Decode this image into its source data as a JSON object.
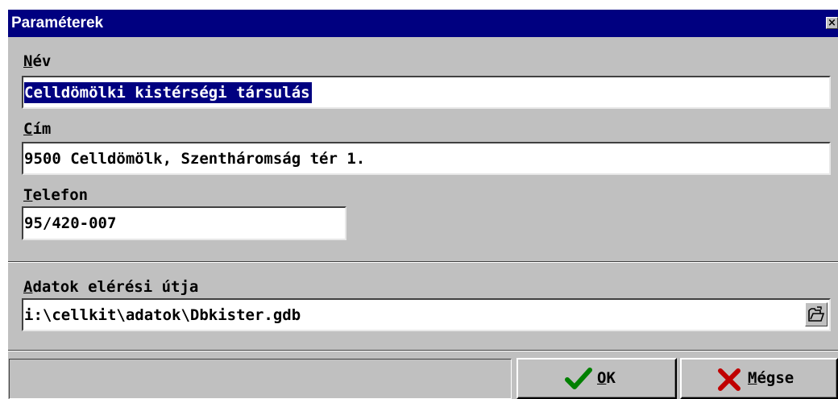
{
  "dialog": {
    "title": "Paraméterek",
    "close_glyph": "×"
  },
  "name": {
    "label_first": "N",
    "label_rest": "év",
    "value": "Celldömölki kistérségi társulás"
  },
  "address": {
    "label_first": "C",
    "label_rest": "ím",
    "value": "9500 Celldömölk, Szentháromság tér 1."
  },
  "phone": {
    "label_first": "T",
    "label_rest": "elefon",
    "value": "95/420-007"
  },
  "data_path": {
    "label_first": "A",
    "label_rest": "datok elérési útja",
    "value": "i:\\cellkit\\adatok\\Dbkister.gdb",
    "browse_icon": "open-folder-icon"
  },
  "buttons": {
    "ok": {
      "label_first": "O",
      "label_rest": "K",
      "icon": "checkmark-icon",
      "icon_color": "#008000"
    },
    "cancel": {
      "label_first": "M",
      "label_rest": "égse",
      "icon": "x-icon",
      "icon_color": "#c00000"
    }
  },
  "colors": {
    "titlebar": "#000080",
    "face": "#c0c0c0",
    "selection": "#000080"
  }
}
